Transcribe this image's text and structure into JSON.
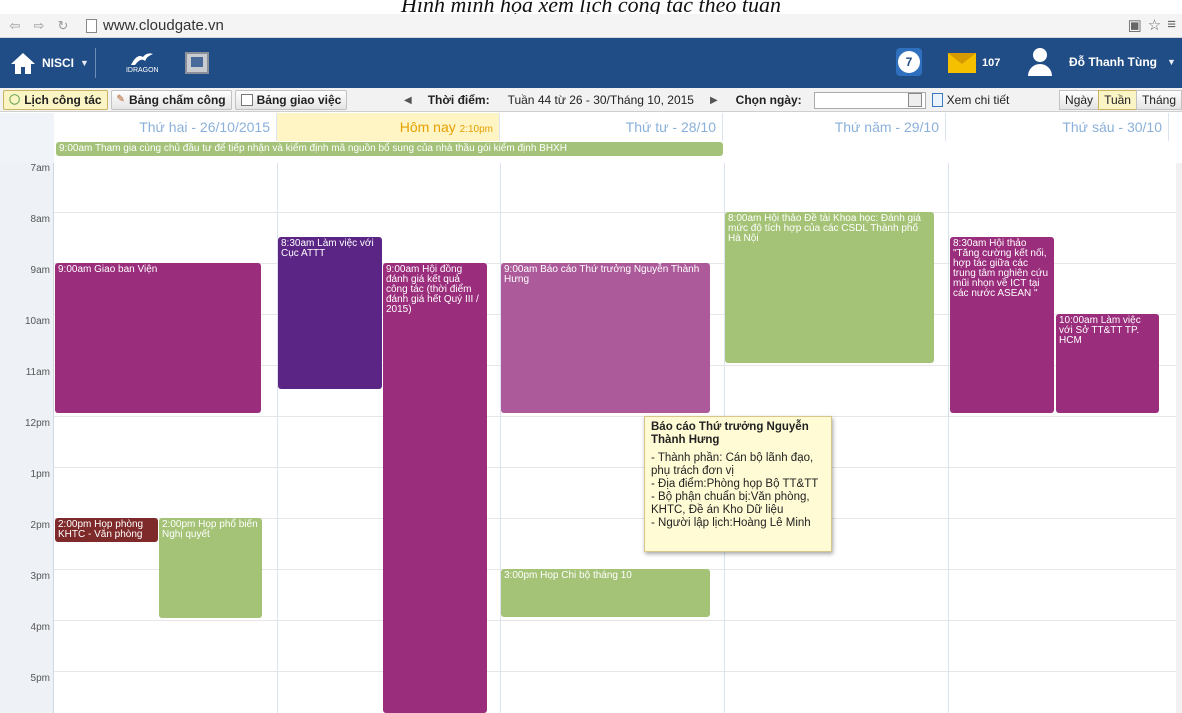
{
  "caption": "Hình minh họa xem lịch công tác theo tuần",
  "browser": {
    "url": "www.cloudgate.vn"
  },
  "topbar": {
    "org": "NISCI",
    "logo_text": "IDRAGON",
    "calendar_day": "7",
    "mail_count": "107",
    "user_name": "Đỗ Thanh Tùng"
  },
  "toolbar": {
    "tabs": [
      "Lịch công tác",
      "Bảng chấm công",
      "Bảng giao việc"
    ],
    "time_label": "Thời điểm:",
    "week_text": "Tuần 44 từ 26 - 30/Tháng 10, 2015",
    "choose_date_label": "Chọn ngày:",
    "date_value": "",
    "detail_link": "Xem chi tiết",
    "views": [
      "Ngày",
      "Tuần",
      "Tháng"
    ]
  },
  "days": [
    "Thứ hai - 26/10/2015",
    "Hôm nay",
    "Thứ tư - 28/10",
    "Thứ năm - 29/10",
    "Thứ sáu - 30/10"
  ],
  "today_time": "2:10pm",
  "allday_event": "9:00am Tham gia cùng chủ đầu tư để tiếp nhận và kiểm định mã nguồn bổ sung của nhà thầu gói kiểm định BHXH",
  "hours": [
    "7am",
    "8am",
    "9am",
    "10am",
    "11am",
    "12pm",
    "1pm",
    "2pm",
    "3pm",
    "4pm",
    "5pm"
  ],
  "events": [
    {
      "text": "9:00am Giao ban Viện",
      "color": "#9a2d7c"
    },
    {
      "text": "8:30am Làm việc với Cục ATTT",
      "color": "#5a2585"
    },
    {
      "text": "9:00am Hội đồng đánh giá kết quả công tác (thời điểm đánh giá hết Quý III / 2015)",
      "color": "#9a2d7c"
    },
    {
      "text": "9:00am Báo cáo Thứ trưởng Nguyễn Thành Hưng",
      "color": "#ac5a9a"
    },
    {
      "text": "8:00am Hội thảo Đề tài Khoa học: Đánh giá mức độ tích hợp của các CSDL Thành phố Hà Nội",
      "color": "#a5c377"
    },
    {
      "text": "8:30am Hội thảo \"Tăng cường kết nối, hợp tác giữa các trung tâm nghiên cứu mũi nhọn về ICT tại các nước ASEAN \"",
      "color": "#9a2d7c"
    },
    {
      "text": "10:00am Làm việc với Sở TT&TT TP. HCM",
      "color": "#9a2d7c"
    },
    {
      "text": "2:00pm Họp phòng KHTC - Văn phòng",
      "color": "#7f2a2a"
    },
    {
      "text": "2:00pm Họp phổ biến Nghị quyết",
      "color": "#a5c377"
    },
    {
      "text": "3:00pm Họp Chi bộ tháng 10",
      "color": "#a5c377"
    }
  ],
  "tooltip": {
    "title": "Báo cáo Thứ trưởng Nguyễn Thành Hưng",
    "lines": [
      "- Thành phần: Cán bộ lãnh đạo, phụ trách đơn vị",
      "- Địa điểm:Phòng họp Bộ TT&TT",
      "- Bộ phận chuẩn bị:Văn phòng, KHTC, Đề án Kho Dữ liệu",
      "- Người lập lịch:Hoàng Lê Minh"
    ]
  }
}
